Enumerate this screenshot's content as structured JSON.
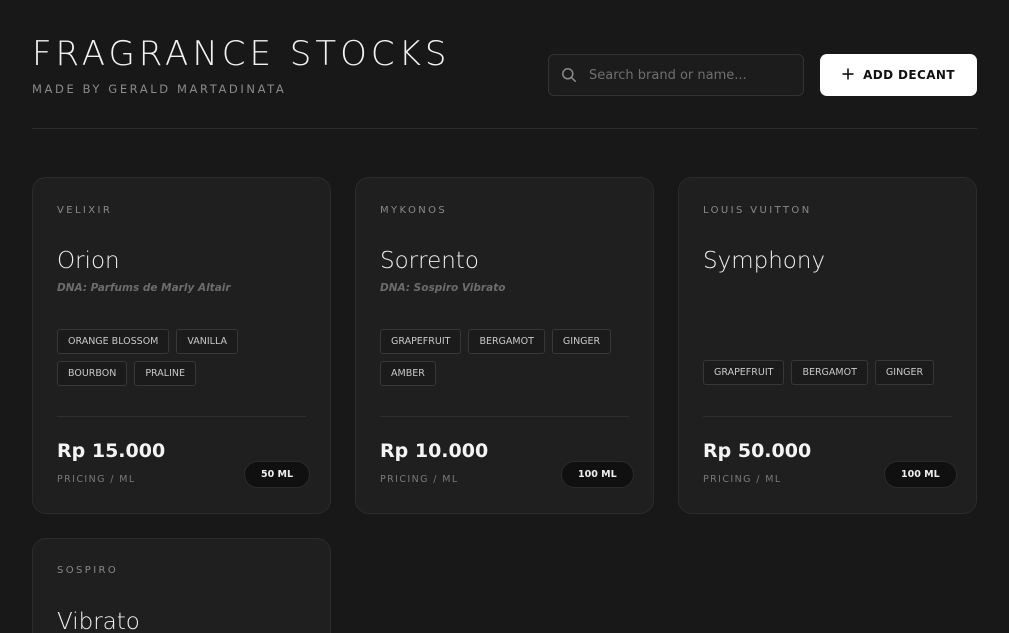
{
  "header": {
    "title": "FRAGRANCE STOCKS",
    "subtitle": "MADE BY GERALD MARTADINATA",
    "search_placeholder": "Search brand or name...",
    "add_button_label": "ADD DECANT"
  },
  "pricing_label": "PRICING / ML",
  "cards": [
    {
      "brand": "VELIXIR",
      "name": "Orion",
      "dna": "DNA: Parfums de Marly Altair",
      "notes": [
        "ORANGE BLOSSOM",
        "VANILLA",
        "BOURBON",
        "PRALINE"
      ],
      "price": "Rp 15.000",
      "volume": "50 ML"
    },
    {
      "brand": "MYKONOS",
      "name": "Sorrento",
      "dna": "DNA: Sospiro Vibrato",
      "notes": [
        "GRAPEFRUIT",
        "BERGAMOT",
        "GINGER",
        "AMBER"
      ],
      "price": "Rp 10.000",
      "volume": "100 ML"
    },
    {
      "brand": "LOUIS VUITTON",
      "name": "Symphony",
      "dna": "",
      "notes": [
        "GRAPEFRUIT",
        "BERGAMOT",
        "GINGER"
      ],
      "price": "Rp 50.000",
      "volume": "100 ML"
    },
    {
      "brand": "SOSPIRO",
      "name": "Vibrato"
    }
  ]
}
